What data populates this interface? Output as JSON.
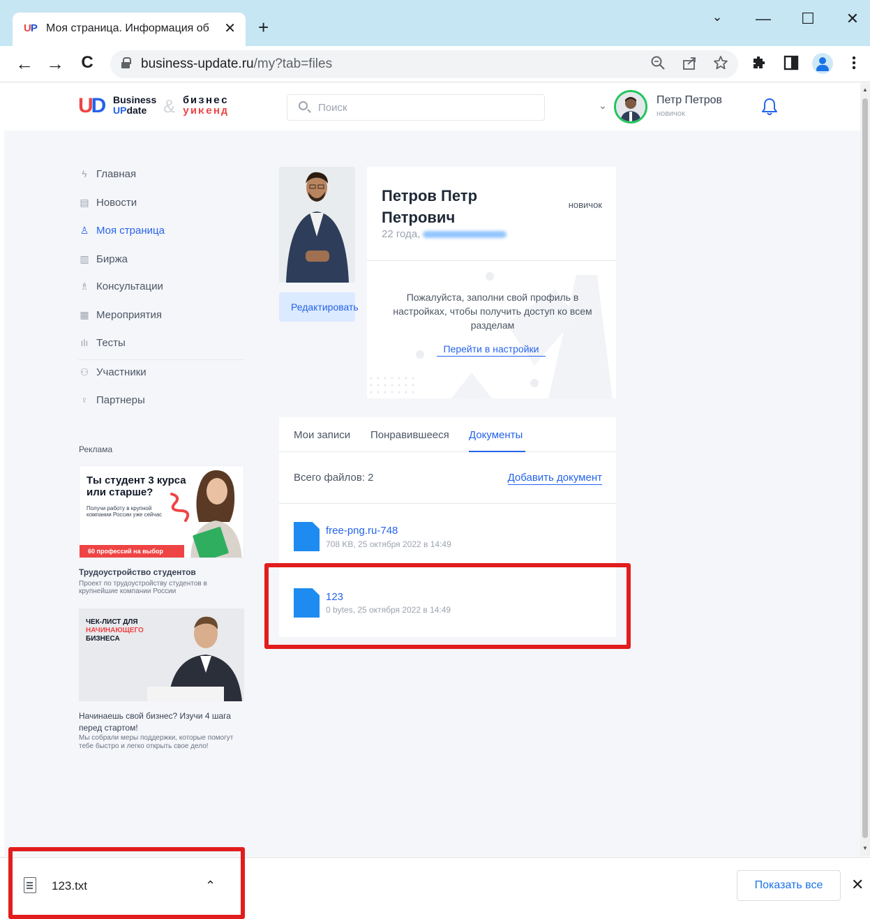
{
  "browser": {
    "tab_logo": "UP",
    "tab_title": "Моя страница. Информация об",
    "tab_close": "✕",
    "new_tab": "+",
    "window_controls": {
      "dropdown": "⌄",
      "minimize": "—",
      "maximize": "☐",
      "close": "✕"
    },
    "nav": {
      "back": "←",
      "forward": "→",
      "reload": "C"
    },
    "url_host": "business-update.ru",
    "url_path": "/my?tab=files",
    "icons": [
      "zoom-icon",
      "share-icon",
      "star-icon",
      "extensions-icon",
      "sidepanel-icon",
      "profile-icon",
      "menu-icon"
    ]
  },
  "site": {
    "logo_business": "Business",
    "logo_update_up": "UP",
    "logo_update_rest": "date",
    "logo_amp": "&",
    "logo_biznes": "бизнес",
    "logo_weekend": "уикенд",
    "search_placeholder": "Поиск",
    "user_name": "Петр Петров",
    "user_role": "новичок"
  },
  "menu": [
    {
      "label": "Главная",
      "icon": "lightning-icon"
    },
    {
      "label": "Новости",
      "icon": "newspaper-icon"
    },
    {
      "label": "Моя страница",
      "icon": "user-icon",
      "active": true
    },
    {
      "label": "Биржа",
      "icon": "building-icon"
    },
    {
      "label": "Консультации",
      "icon": "consult-icon"
    },
    {
      "label": "Мероприятия",
      "icon": "calendar-icon"
    },
    {
      "label": "Тесты",
      "icon": "bars-icon"
    },
    {
      "label": "Участники",
      "icon": "users-icon"
    },
    {
      "label": "Партнеры",
      "icon": "partner-icon"
    }
  ],
  "ads": {
    "label": "Реклама",
    "ad1": {
      "headline": "Ты студент 3 курса или старше?",
      "subline": "Получи работу в крупной компании России уже сейчас",
      "tag": "60 профессий на выбор",
      "title": "Трудоустройство студентов",
      "desc": "Проект по трудоустройству студентов в крупнейшие компании России"
    },
    "ad2": {
      "headline_1": "ЧЕК-ЛИСТ ДЛЯ",
      "headline_2": "НАЧИНАЮЩЕГО",
      "headline_3": "БИЗНЕСА",
      "title": "Начинаешь свой бизнес? Изучи 4 шага перед стартом!",
      "desc": "Мы собрали меры поддержки, которые помогут тебе быстро и легко открыть свое дело!"
    }
  },
  "profile": {
    "full_name": "Петров Петр Петрович",
    "badge": "новичок",
    "age": "22 года,",
    "edit_button": "Редактировать",
    "notice": "Пожалуйста, заполни свой профиль в настройках, чтобы получить доступ ко всем разделам",
    "settings_link": "Перейти в настройки"
  },
  "tabs": [
    {
      "label": "Мои записи"
    },
    {
      "label": "Понравившееся"
    },
    {
      "label": "Документы",
      "active": true
    }
  ],
  "files": {
    "count_label": "Всего файлов: 2",
    "add_label": "Добавить документ",
    "items": [
      {
        "name": "free-png.ru-748",
        "meta": "708 KB, 25 октября 2022 в 14:49"
      },
      {
        "name": "123",
        "meta": "0 bytes, 25 октября 2022 в 14:49"
      }
    ]
  },
  "downloads": {
    "file_name": "123.txt",
    "chevron": "⌃",
    "show_all": "Показать все",
    "close": "✕"
  },
  "colors": {
    "accent": "#2563eb",
    "highlight": "#e11d1d",
    "file_icon": "#1d8bf0",
    "tabbar": "#c6e6f3",
    "page_bg": "#f5f6fa"
  }
}
